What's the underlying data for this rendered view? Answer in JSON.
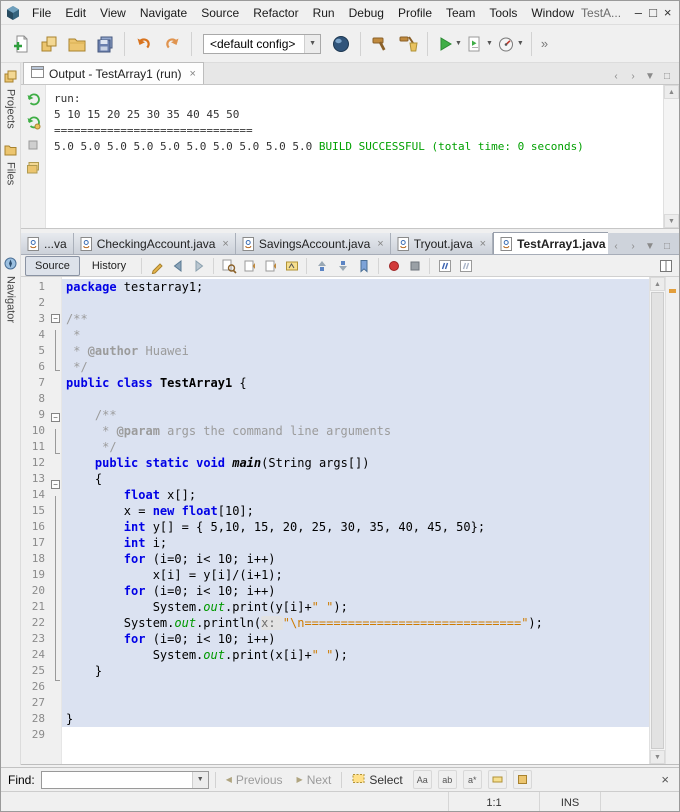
{
  "icons": {
    "close": "×",
    "chevron_left": "‹",
    "chevron_right": "›",
    "dropdown_small": "▼",
    "scroll_up": "▲",
    "scroll_down": "▼",
    "minimize": "–",
    "maximize": "□",
    "restore": "□",
    "prev_arrow": "◀",
    "next_arrow": "▶",
    "overflow": "»",
    "fold_minus": "−",
    "match_case": "Aa",
    "whole_words": "ab",
    "regex": "a*"
  },
  "window": {
    "title": "TestA...",
    "menus": [
      "File",
      "Edit",
      "View",
      "Navigate",
      "Source",
      "Refactor",
      "Run",
      "Debug",
      "Profile",
      "Team",
      "Tools",
      "Window"
    ]
  },
  "toolbar": {
    "config_value": "<default config>"
  },
  "left_rail": {
    "projects_label": "Projects",
    "files_label": "Files",
    "navigator_label": "Navigator"
  },
  "output": {
    "tab_label": "Output - TestArray1 (run)",
    "lines": [
      [
        {
          "t": "run:",
          "c": "pl"
        }
      ],
      [
        {
          "t": "5 10 15 20 25 30 35 40 45 50",
          "c": "pl"
        }
      ],
      [
        {
          "t": "==============================",
          "c": "pl"
        }
      ],
      [
        {
          "t": "5.0 5.0 5.0 5.0 5.0 5.0 5.0 5.0 5.0 5.0 ",
          "c": "pl"
        },
        {
          "t": "BUILD SUCCESSFUL (total time: 0 seconds)",
          "c": "green"
        }
      ]
    ]
  },
  "editor": {
    "tabs": [
      {
        "label": "...va",
        "active": false,
        "close": false
      },
      {
        "label": "CheckingAccount.java",
        "active": false,
        "close": true
      },
      {
        "label": "SavingsAccount.java",
        "active": false,
        "close": true
      },
      {
        "label": "Tryout.java",
        "active": false,
        "close": true
      },
      {
        "label": "TestArray1.java",
        "active": true,
        "close": true
      }
    ],
    "toolbar": {
      "source_label": "Source",
      "history_label": "History"
    },
    "code": {
      "selection_color": "#dbe2f1",
      "lines": [
        {
          "n": 1,
          "fold": "",
          "sel": true,
          "segs": [
            {
              "t": "package",
              "c": "kw"
            },
            {
              "t": " testarray1;",
              "c": "pl"
            }
          ]
        },
        {
          "n": 2,
          "fold": "",
          "sel": true,
          "segs": []
        },
        {
          "n": 3,
          "fold": "start",
          "sel": true,
          "segs": [
            {
              "t": "/**",
              "c": "cm"
            }
          ]
        },
        {
          "n": 4,
          "fold": "mid",
          "sel": true,
          "segs": [
            {
              "t": " *",
              "c": "cm"
            }
          ]
        },
        {
          "n": 5,
          "fold": "mid",
          "sel": true,
          "segs": [
            {
              "t": " * ",
              "c": "cm"
            },
            {
              "t": "@author",
              "c": "tag"
            },
            {
              "t": " Huawei",
              "c": "cm"
            }
          ]
        },
        {
          "n": 6,
          "fold": "end",
          "sel": true,
          "segs": [
            {
              "t": " */",
              "c": "cm"
            }
          ]
        },
        {
          "n": 7,
          "fold": "",
          "sel": true,
          "segs": [
            {
              "t": "public",
              "c": "kw"
            },
            {
              "t": " ",
              "c": "pl"
            },
            {
              "t": "class",
              "c": "kw"
            },
            {
              "t": " ",
              "c": "pl"
            },
            {
              "t": "TestArray1",
              "c": "cls"
            },
            {
              "t": " {",
              "c": "pl"
            }
          ]
        },
        {
          "n": 8,
          "fold": "",
          "sel": true,
          "segs": []
        },
        {
          "n": 9,
          "fold": "start",
          "sel": true,
          "segs": [
            {
              "t": "    ",
              "c": "pl"
            },
            {
              "t": "/**",
              "c": "cm"
            }
          ]
        },
        {
          "n": 10,
          "fold": "mid",
          "sel": true,
          "segs": [
            {
              "t": "     ",
              "c": "pl"
            },
            {
              "t": "* ",
              "c": "cm"
            },
            {
              "t": "@param",
              "c": "tag"
            },
            {
              "t": " args the command line arguments",
              "c": "cm"
            }
          ]
        },
        {
          "n": 11,
          "fold": "end",
          "sel": true,
          "segs": [
            {
              "t": "     ",
              "c": "pl"
            },
            {
              "t": "*/",
              "c": "cm"
            }
          ]
        },
        {
          "n": 12,
          "fold": "",
          "sel": true,
          "segs": [
            {
              "t": "    ",
              "c": "pl"
            },
            {
              "t": "public",
              "c": "kw"
            },
            {
              "t": " ",
              "c": "pl"
            },
            {
              "t": "static",
              "c": "kw"
            },
            {
              "t": " ",
              "c": "pl"
            },
            {
              "t": "void",
              "c": "kw"
            },
            {
              "t": " ",
              "c": "pl"
            },
            {
              "t": "main",
              "c": "decl"
            },
            {
              "t": "(String args[])",
              "c": "pl"
            }
          ]
        },
        {
          "n": 13,
          "fold": "start",
          "sel": true,
          "segs": [
            {
              "t": "    {",
              "c": "pl"
            }
          ]
        },
        {
          "n": 14,
          "fold": "mid",
          "sel": true,
          "segs": [
            {
              "t": "        ",
              "c": "pl"
            },
            {
              "t": "float",
              "c": "kw"
            },
            {
              "t": " x[];",
              "c": "pl"
            }
          ]
        },
        {
          "n": 15,
          "fold": "mid",
          "sel": true,
          "segs": [
            {
              "t": "        x = ",
              "c": "pl"
            },
            {
              "t": "new",
              "c": "kw"
            },
            {
              "t": " ",
              "c": "pl"
            },
            {
              "t": "float",
              "c": "kw"
            },
            {
              "t": "[10];",
              "c": "pl"
            }
          ]
        },
        {
          "n": 16,
          "fold": "mid",
          "sel": true,
          "segs": [
            {
              "t": "        ",
              "c": "pl"
            },
            {
              "t": "int",
              "c": "kw"
            },
            {
              "t": " y[] = { 5,10, 15, 20, 25, 30, 35, 40, 45, 50};",
              "c": "pl"
            }
          ]
        },
        {
          "n": 17,
          "fold": "mid",
          "sel": true,
          "segs": [
            {
              "t": "        ",
              "c": "pl"
            },
            {
              "t": "int",
              "c": "kw"
            },
            {
              "t": " i;",
              "c": "pl"
            }
          ]
        },
        {
          "n": 18,
          "fold": "mid",
          "sel": true,
          "segs": [
            {
              "t": "        ",
              "c": "pl"
            },
            {
              "t": "for",
              "c": "kw"
            },
            {
              "t": " (i=0; i< 10; i++)",
              "c": "pl"
            }
          ]
        },
        {
          "n": 19,
          "fold": "mid",
          "sel": true,
          "segs": [
            {
              "t": "            x[i] = y[i]/(i+1);",
              "c": "pl"
            }
          ]
        },
        {
          "n": 20,
          "fold": "mid",
          "sel": true,
          "segs": [
            {
              "t": "        ",
              "c": "pl"
            },
            {
              "t": "for",
              "c": "kw"
            },
            {
              "t": " (i=0; i< 10; i++)",
              "c": "pl"
            }
          ]
        },
        {
          "n": 21,
          "fold": "mid",
          "sel": true,
          "segs": [
            {
              "t": "            System.",
              "c": "pl"
            },
            {
              "t": "out",
              "c": "fld"
            },
            {
              "t": ".print(y[i]+",
              "c": "pl"
            },
            {
              "t": "\" \"",
              "c": "str"
            },
            {
              "t": ");",
              "c": "pl"
            }
          ]
        },
        {
          "n": 22,
          "fold": "mid",
          "sel": true,
          "segs": [
            {
              "t": "        System.",
              "c": "pl"
            },
            {
              "t": "out",
              "c": "fld"
            },
            {
              "t": ".println(",
              "c": "pl"
            },
            {
              "t": "x: ",
              "c": "hint"
            },
            {
              "t": "\"\\n==============================\"",
              "c": "str"
            },
            {
              "t": ");",
              "c": "pl"
            }
          ]
        },
        {
          "n": 23,
          "fold": "mid",
          "sel": true,
          "segs": [
            {
              "t": "        ",
              "c": "pl"
            },
            {
              "t": "for",
              "c": "kw"
            },
            {
              "t": " (i=0; i< 10; i++)",
              "c": "pl"
            }
          ]
        },
        {
          "n": 24,
          "fold": "mid",
          "sel": true,
          "segs": [
            {
              "t": "            System.",
              "c": "pl"
            },
            {
              "t": "out",
              "c": "fld"
            },
            {
              "t": ".print(x[i]+",
              "c": "pl"
            },
            {
              "t": "\" \"",
              "c": "str"
            },
            {
              "t": ");",
              "c": "pl"
            }
          ]
        },
        {
          "n": 25,
          "fold": "end",
          "sel": true,
          "segs": [
            {
              "t": "    }",
              "c": "pl"
            }
          ]
        },
        {
          "n": 26,
          "fold": "",
          "sel": true,
          "segs": []
        },
        {
          "n": 27,
          "fold": "",
          "sel": true,
          "segs": []
        },
        {
          "n": 28,
          "fold": "",
          "sel": true,
          "segs": [
            {
              "t": "}",
              "c": "pl"
            }
          ]
        },
        {
          "n": 29,
          "fold": "",
          "sel": false,
          "segs": []
        }
      ]
    }
  },
  "find_bar": {
    "label": "Find:",
    "previous_label": "Previous",
    "next_label": "Next",
    "select_label": "Select"
  },
  "status_bar": {
    "caret": "1:1",
    "mode": "INS"
  }
}
